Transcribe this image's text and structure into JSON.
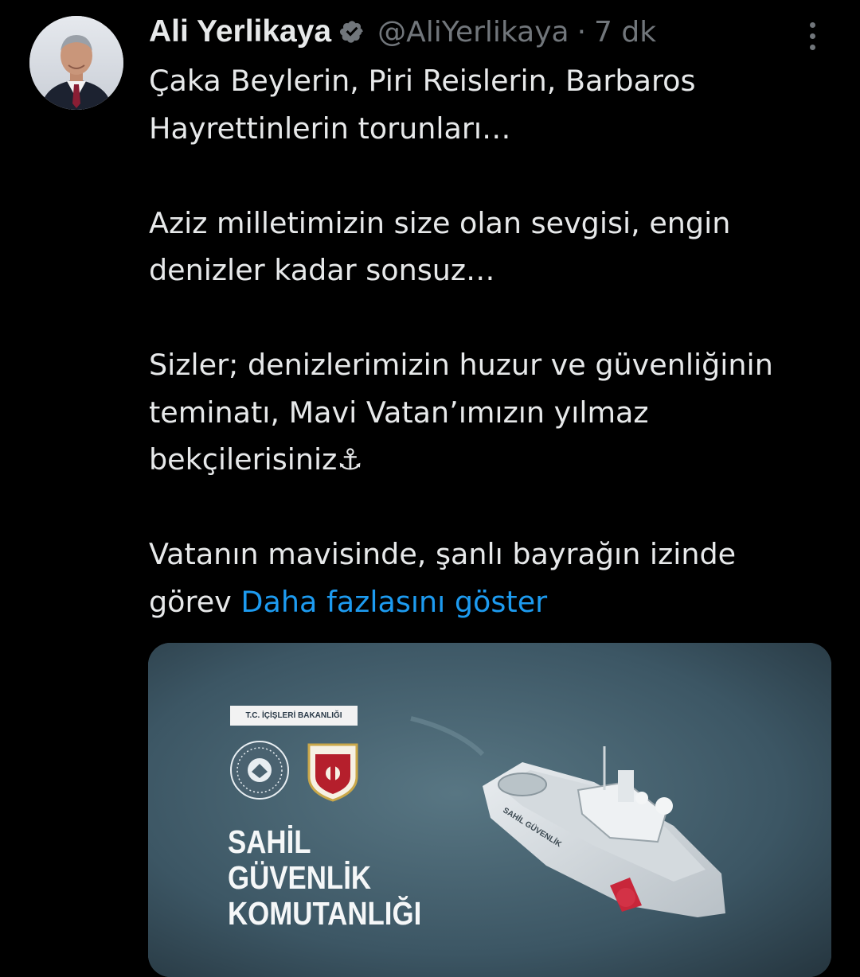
{
  "author": {
    "display_name": "Ali Yerlikaya",
    "handle": "@AliYerlikaya",
    "separator": "·",
    "time": "7 dk",
    "verified": true,
    "verified_color": "#71767b"
  },
  "tweet": {
    "lines": [
      "Çaka Beylerin, Piri Reislerin, Barbaros",
      "Hayrettinlerin torunları…",
      "",
      "Aziz milletimizin size olan sevgisi, engin",
      "denizler kadar sonsuz…",
      "",
      "Sizler; denizlerimizin huzur ve güvenliğinin",
      "teminatı, Mavi Vatan’ımızın yılmaz",
      "bekçilerisiniz⚓",
      "",
      "Vatanın mavisinde, şanlı bayrağın izinde"
    ],
    "last_line_start": "görev",
    "show_more": "Daha fazlasını göster",
    "link_color": "#1d9bf0"
  },
  "media": {
    "ministry_label": "T.C. İÇİŞLERİ BAKANLIĞI",
    "title_lines": [
      "SAHİL",
      "GÜVENLİK",
      "KOMUTANLIĞI"
    ],
    "ship_hull_text": "SAHİL GÜVENLİK",
    "sea_color": "#3e5866"
  },
  "icons": {
    "verified": "verified-badge-icon",
    "more": "more-options-icon"
  }
}
